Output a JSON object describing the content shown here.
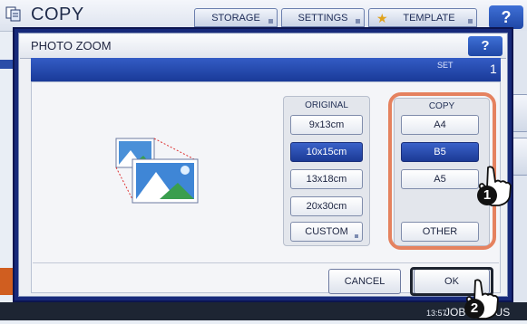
{
  "app": {
    "title": "COPY",
    "tabs": [
      "STORAGE",
      "SETTINGS",
      "TEMPLATE"
    ],
    "help": "?"
  },
  "dialog": {
    "title": "PHOTO ZOOM",
    "help": "?",
    "set_label": "SET",
    "set_count": "1",
    "original": {
      "label": "ORIGINAL",
      "options": [
        "9x13cm",
        "10x15cm",
        "13x18cm",
        "20x30cm",
        "CUSTOM"
      ],
      "selected": "10x15cm"
    },
    "copy": {
      "label": "COPY",
      "options": [
        "A4",
        "B5",
        "A5",
        "OTHER"
      ],
      "selected": "B5"
    },
    "buttons": {
      "cancel": "CANCEL",
      "ok": "OK"
    }
  },
  "callouts": {
    "step1": "1",
    "step2": "2"
  },
  "status_bar": {
    "time": "13:57",
    "label": "JOB STATUS"
  },
  "colors": {
    "accent": "#1f47a6",
    "highlight_border": "#e5825f",
    "selected": "#2a4fb5"
  },
  "icons": [
    "copy-app-icon",
    "star-icon",
    "help-icon",
    "photo-zoom-icon",
    "pointing-hand-icon"
  ]
}
